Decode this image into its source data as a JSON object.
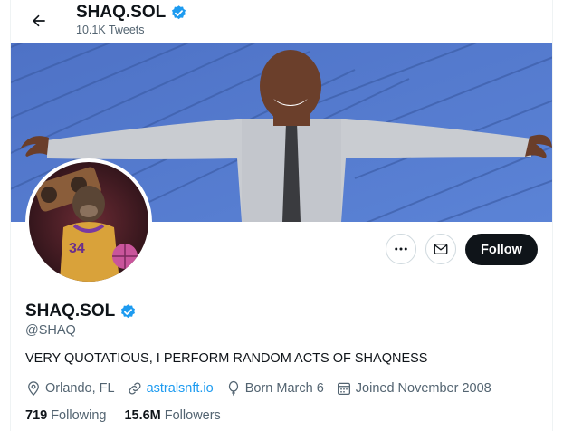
{
  "header": {
    "title": "SHAQ.SOL",
    "tweets_count": "10.1K Tweets",
    "back_icon": "arrow-left-icon"
  },
  "profile": {
    "name": "SHAQ.SOL",
    "verified": true,
    "handle": "@SHAQ",
    "bio": "VERY QUOTATIOUS, I PERFORM RANDOM ACTS OF SHAQNESS",
    "location": "Orlando, FL",
    "website": "astralsnft.io",
    "birthday": "Born March 6",
    "joined": "Joined November 2008",
    "following_count": "719",
    "following_label": "Following",
    "followers_count": "15.6M",
    "followers_label": "Followers"
  },
  "actions": {
    "more_icon": "more-dots-icon",
    "message_icon": "envelope-icon",
    "follow_label": "Follow"
  },
  "colors": {
    "accent": "#1d9bf0",
    "text": "#0f1419",
    "secondary_text": "#536471",
    "follow_button_bg": "#0f1419",
    "banner_wall": "#4a6fc4"
  }
}
